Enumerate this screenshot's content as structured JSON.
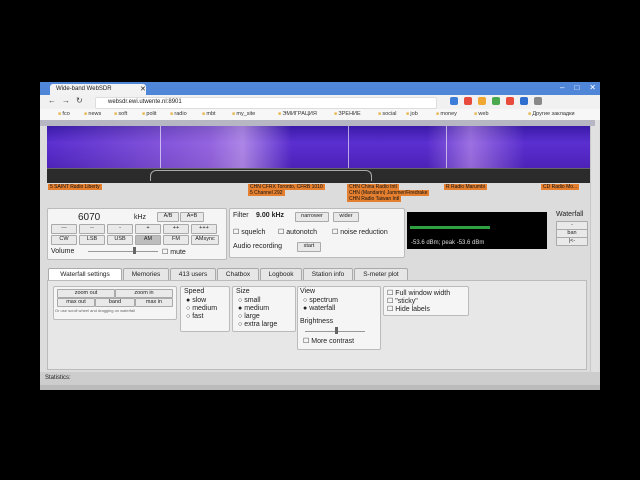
{
  "browser": {
    "tab_title": "Wide-band WebSDR",
    "url": "websdr.ewi.utwente.nl:8901",
    "bookmarks": [
      "fco",
      "news",
      "soft",
      "polit",
      "radio",
      "mbt",
      "my_site",
      "ЭМИГРАЦИЯ",
      "ЗРЕНИЕ",
      "social",
      "job",
      "money",
      "web",
      "Другие закладки"
    ]
  },
  "spectrum": {
    "labels": [
      "5 SAINT Radio Liberty",
      "CHN CFRX Toronto, CFRB 1010",
      "5 Channel 292",
      "CHN China Radio Intl",
      "CHN (Mandarin) Jammer/Firedrake",
      "CHN Radio Taiwan Intl",
      "R Radio Marumbi",
      "CD Radio Mo..."
    ]
  },
  "tuning": {
    "frequency": "6070",
    "unit": "kHz",
    "ab": "A/B",
    "aeqb": "A=B",
    "steps": [
      "---",
      "--",
      "-",
      "+",
      "++",
      "+++"
    ],
    "modes": [
      "CW",
      "LSB",
      "USB",
      "AM",
      "FM",
      "AMsync"
    ],
    "active_mode": "AM",
    "volume_label": "Volume",
    "mute_label": "mute"
  },
  "filter": {
    "label": "Filter",
    "bandwidth": "9.00 kHz",
    "narrower": "narrower",
    "wider": "wider",
    "squelch": "squelch",
    "autonotch": "autonotch",
    "noise_reduction": "noise reduction",
    "audio_recording": "Audio recording",
    "start": "start"
  },
  "smeter": {
    "reading": "-53.6 dBm; peak  -53.6 dBm"
  },
  "waterfall_side": {
    "title": "Waterfall",
    "btn1": "-",
    "btn2": "ban",
    "btn3": "|<-"
  },
  "tabs": [
    "Waterfall settings",
    "Memories",
    "413 users",
    "Chatbox",
    "Logbook",
    "Station info",
    "S-meter plot"
  ],
  "waterfall_settings": {
    "zoom_out": "zoom out",
    "zoom_in": "zoom in",
    "max_out": "max out",
    "band": "band",
    "max_in": "max in",
    "hint": "Or use scroll wheel and dragging on waterfall",
    "speed_title": "Speed",
    "speed": [
      "slow",
      "medium",
      "fast"
    ],
    "speed_sel": "slow",
    "size_title": "Size",
    "size": [
      "small",
      "medium",
      "large",
      "extra large"
    ],
    "size_sel": "medium",
    "view_title": "View",
    "view": [
      "spectrum",
      "waterfall"
    ],
    "view_sel": "waterfall",
    "brightness_title": "Brightness",
    "more_contrast": "More contrast",
    "full_window": "Full window width",
    "sticky": "\"sticky\"",
    "hide_labels": "Hide labels"
  },
  "statistics": "Statistics:"
}
